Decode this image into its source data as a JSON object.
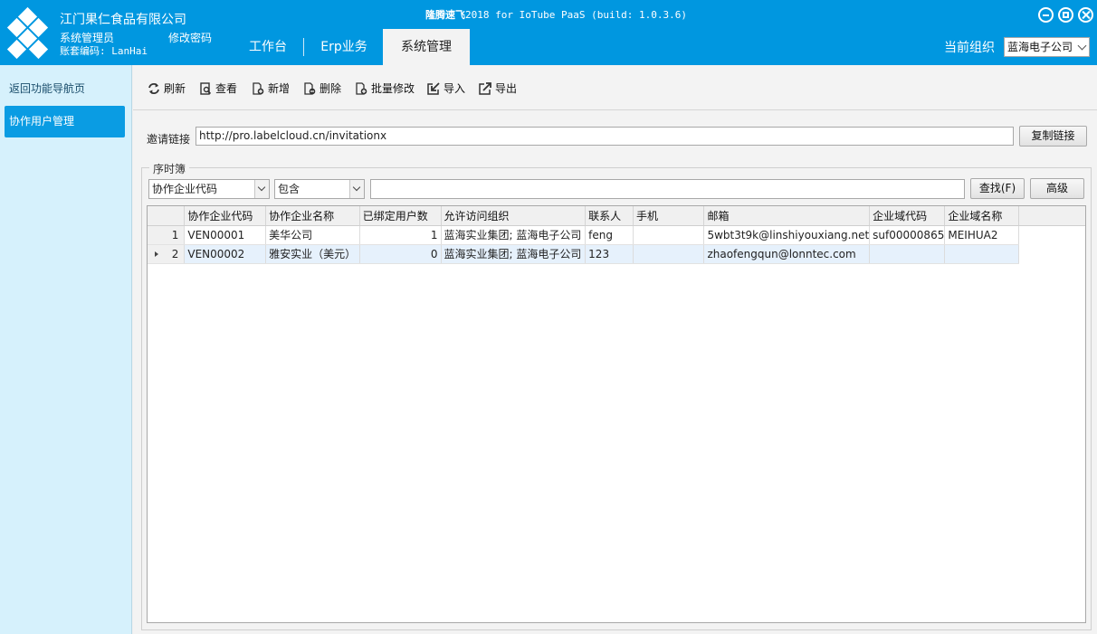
{
  "header": {
    "company": "江门果仁食品有限公司",
    "user_role": "系统管理员",
    "change_password": "修改密码",
    "account_code": "账套编码: LanHai",
    "app_title_brand": "隆腾速飞",
    "app_title_rest": "2018 for IoTube PaaS (build: 1.0.3.6)",
    "tabs": [
      "工作台",
      "Erp业务",
      "系统管理"
    ],
    "active_tab": "系统管理",
    "org_label": "当前组织",
    "org_value": "蓝海电子公司",
    "brand_color": "#0097e0"
  },
  "sidebar": {
    "items": [
      "返回功能导航页",
      "协作用户管理"
    ],
    "active_item": "协作用户管理"
  },
  "toolbar": {
    "refresh": "刷新",
    "view": "查看",
    "add": "新增",
    "delete": "删除",
    "batch_edit": "批量修改",
    "import": "导入",
    "export": "导出"
  },
  "invite": {
    "label": "邀请链接",
    "url": "http://pro.labelcloud.cn/invitationx",
    "copy_button": "复制链接"
  },
  "filter": {
    "group_title": "序时簿",
    "field": "协作企业代码",
    "operator": "包含",
    "value": "",
    "search_button": "查找(F)",
    "advanced_button": "高级"
  },
  "table": {
    "columns": [
      "协作企业代码",
      "协作企业名称",
      "已绑定用户数",
      "允许访问组织",
      "联系人",
      "手机",
      "邮箱",
      "企业域代码",
      "企业域名称"
    ],
    "rows": [
      {
        "no": "1",
        "code": "VEN00001",
        "name": "美华公司",
        "bound": "1",
        "orgs": "蓝海实业集团; 蓝海电子公司",
        "contact": "feng",
        "phone": "",
        "email": "5wbt3t9k@linshiyouxiang.net",
        "domain_code": "suf00000865",
        "domain_name": "MEIHUA2"
      },
      {
        "no": "2",
        "code": "VEN00002",
        "name": "雅安实业（美元）",
        "bound": "0",
        "orgs": "蓝海实业集团; 蓝海电子公司",
        "contact": "123",
        "phone": "",
        "email": "zhaofengqun@lonntec.com",
        "domain_code": "",
        "domain_name": ""
      }
    ],
    "selected_row": "2"
  },
  "icons": [
    "refresh-icon",
    "view-icon",
    "add-icon",
    "delete-icon",
    "batch-edit-icon",
    "import-icon",
    "export-icon",
    "minimize-icon",
    "maximize-icon",
    "close-icon"
  ]
}
